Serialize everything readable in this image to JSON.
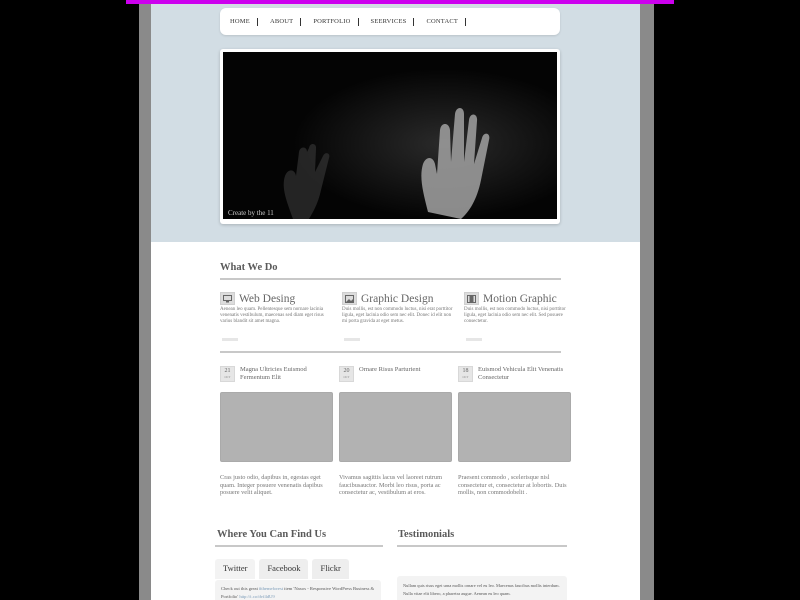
{
  "colors": {
    "accent_bar": "#cc00ee",
    "hero_bg": "#d2dde4",
    "thumb": "#b2b2b2"
  },
  "nav": {
    "items": [
      "HOME",
      "ABOUT",
      "PORTFOLIO",
      "SEERVICES",
      "CONTACT"
    ]
  },
  "slider": {
    "caption": "Create by the 11"
  },
  "what_we_do": {
    "title": "What We Do",
    "services": [
      {
        "icon": "monitor-icon",
        "title": "Web Desing",
        "text": "Aenean leo quam. Pellentesque sem nornare lacinia venenatis vestibulum, maecenas sed diam eget risus varius blandit sit amet magna."
      },
      {
        "icon": "image-icon",
        "title": "Graphic Design",
        "text": "Duis mollis, est non commodo luctus, nisi erat porttitor ligula, eget lacinia odio sem nec elit. Donec id elit non mi porta gravida at eget metus."
      },
      {
        "icon": "film-icon",
        "title": "Motion Graphic",
        "text": "Duis mollis, est non commodo luctus, nisi porttitor ligula, eget lacinia odio sem nec elit. Sed posuere consectetur."
      }
    ]
  },
  "posts": [
    {
      "day": "21",
      "month": "OCT",
      "title": "Magna Ultricies Euismod Fermentum Elit",
      "text": "Cras justo odio, dapibus in, egestas eget quam. Integer posuere venenatis dapibus posuere velit aliquet."
    },
    {
      "day": "20",
      "month": "OCT",
      "title": "Ornare Risus Parturient",
      "text": "Vivamus sagittis lacus vel laoreet rutrum faucibusauctor. Morbi leo risus, porta ac consectetur ac, vestibulum at eros."
    },
    {
      "day": "18",
      "month": "OCT",
      "title": "Euismod Vehicula Elit Venenatis Consectetur",
      "text": "Praesent commodo , scelerisque nisl consectetur et, consectetur at lobortis. Duis mollis, non commodobelit ."
    }
  ],
  "find_us": {
    "title": "Where You Can Find Us",
    "tabs": [
      "Twitter",
      "Facebook",
      "Flickr"
    ],
    "tweet_pre": "Check out this great",
    "tweet_link1": "#themeforest",
    "tweet_mid": "item 'Naxos - Responsive WordPress Business & Portfolio'",
    "tweet_link2": "http://t.co/dvf4dU9"
  },
  "testimonials": {
    "title": "Testimonials",
    "text": "Nullam quis risus eget urna mollis ornare vel eu leo. Maecenas faucibus mollis interdum. Nulla vitae elit libero, a pharetra augue. Aenean eu leo quam."
  }
}
